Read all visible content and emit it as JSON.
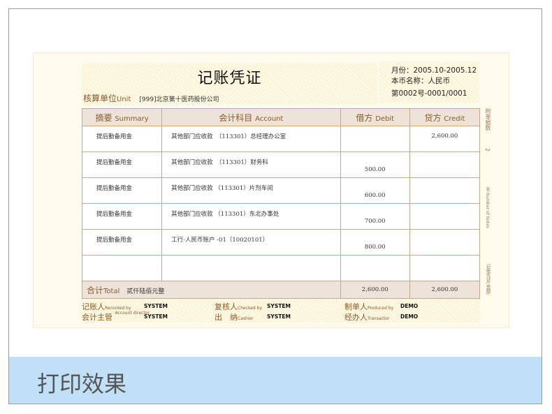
{
  "voucher": {
    "title": "记账凭证",
    "unit_label": "核算单位",
    "unit_label_en": "Unit",
    "unit_value": "[999]北京第十医药股份公司",
    "month": "月份：2005.10-2005.12",
    "currency": "本币名称：人民币",
    "number": "第0002号-0001/0001",
    "headers": [
      {
        "cn": "摘要",
        "en": "Summary"
      },
      {
        "cn": "会计科目",
        "en": "Account"
      },
      {
        "cn": "借方",
        "en": "Debit"
      },
      {
        "cn": "贷方",
        "en": "Credit"
      }
    ],
    "rows": [
      {
        "summary": "提后勤备用金",
        "account": "其他部门应收款　（113301）总经理办公室",
        "debit": "",
        "credit": "2,600.00"
      },
      {
        "summary": "提后勤备用金",
        "account": "其他部门应收款　（113301）财务科",
        "debit": "500.00",
        "credit": ""
      },
      {
        "summary": "提后勤备用金",
        "account": "其他部门应收款 （113301）片剂车间",
        "debit": "600.00",
        "credit": ""
      },
      {
        "summary": "提后勤备用金",
        "account": "其他部门应收款 （113301）东北办事处",
        "debit": "700.00",
        "credit": ""
      },
      {
        "summary": "提后勤备用金",
        "account": "工行-人民币账户 -01（10020101）",
        "debit": "800.00",
        "credit": ""
      }
    ],
    "total": {
      "cn": "合计",
      "en": "Total",
      "words": "贰仟陆佰元整",
      "debit": "2,600.00",
      "credit": "2,600.00"
    },
    "signatures": [
      {
        "cn": "记账人",
        "en": "Recorded by",
        "value": "SYSTEM"
      },
      {
        "cn": "复核人",
        "en": "Checked by",
        "value": "SYSTEM"
      },
      {
        "cn": "制单人",
        "en": "Produced by",
        "value": "DEMO"
      },
      {
        "cn": "会计主管",
        "en": "Account director",
        "value": "SYSTEM"
      },
      {
        "cn": "出　纳",
        "en": "Cashier",
        "value": "SYSTEM"
      },
      {
        "cn": "经办人",
        "en": "Transactor",
        "value": "DEMO"
      }
    ],
    "side": {
      "attach": "附单据数",
      "count": "2",
      "unit": "张 Number of Notes",
      "footer": "记账凭证(金额)"
    }
  },
  "caption": "打印效果"
}
